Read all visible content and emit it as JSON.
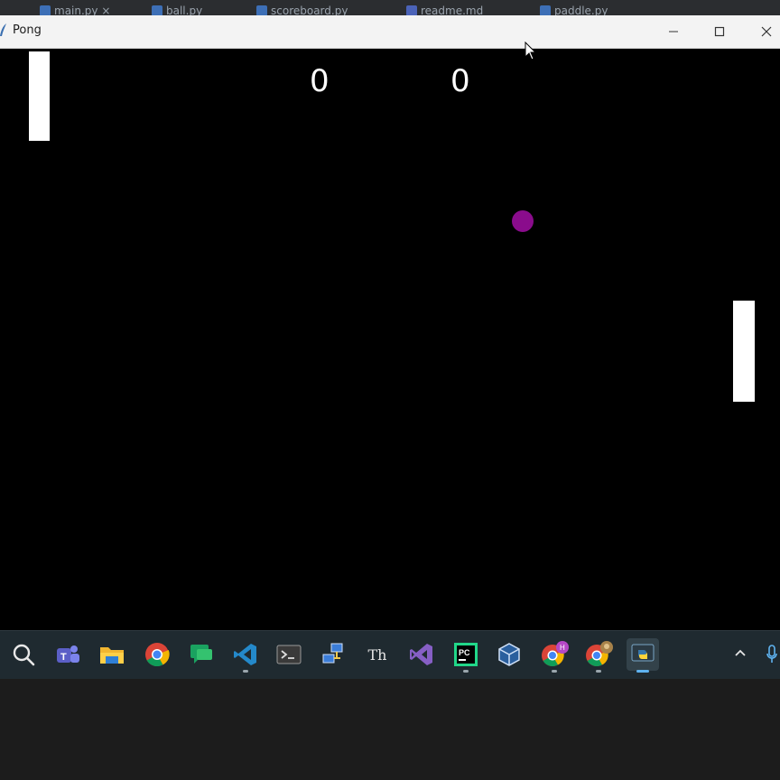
{
  "editor_tabs": [
    {
      "label": "main.py",
      "close": "×"
    },
    {
      "label": "ball.py"
    },
    {
      "label": "scoreboard.py"
    },
    {
      "label": "readme.md"
    },
    {
      "label": "paddle.py"
    }
  ],
  "window": {
    "title": "Pong",
    "controls": {
      "minimize": "minimize-icon",
      "maximize": "maximize-icon",
      "close": "close-icon"
    }
  },
  "game": {
    "score_left": "0",
    "score_right": "0",
    "ball_color": "#8a0c8c",
    "paddle_color": "#ffffff",
    "background": "#000000"
  },
  "taskbar": {
    "icons": [
      "search-icon",
      "teams-icon",
      "file-explorer-icon",
      "chrome-icon",
      "chat-icon",
      "vscode-icon",
      "terminal-icon",
      "network-icon",
      "typora-icon",
      "visual-studio-icon",
      "pycharm-icon",
      "virtualbox-icon",
      "chrome-profile-icon",
      "chrome-profile-2-icon",
      "python-icon"
    ],
    "typora_label": "Th",
    "pycharm_label": "PC",
    "chrome_badge": "H",
    "active": "python-icon"
  }
}
